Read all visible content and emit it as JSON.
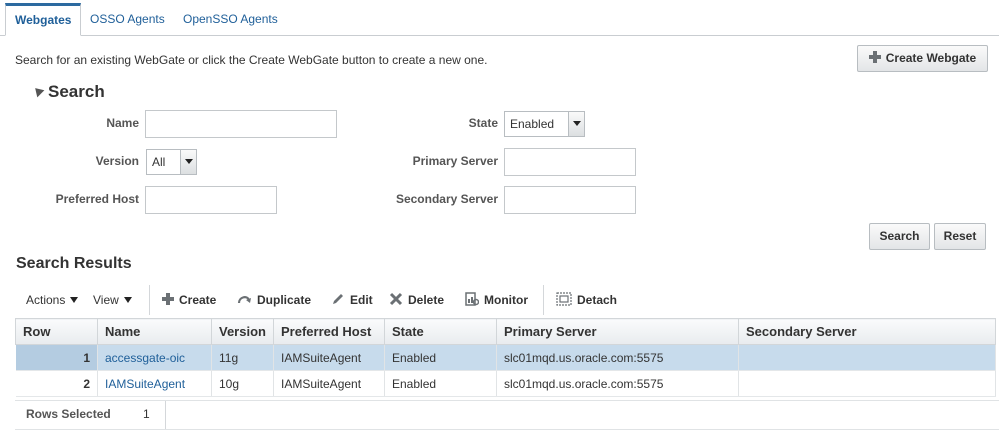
{
  "tabs": [
    {
      "label": "Webgates",
      "active": true
    },
    {
      "label": "OSSO Agents",
      "active": false
    },
    {
      "label": "OpenSSO Agents",
      "active": false
    }
  ],
  "intro_text": "Search for an existing WebGate or click the Create WebGate button to create a new one.",
  "create_button_label": "Create Webgate",
  "search": {
    "title": "Search",
    "fields": {
      "name_label": "Name",
      "state_label": "State",
      "state_value": "Enabled",
      "version_label": "Version",
      "version_value": "All",
      "primary_server_label": "Primary Server",
      "preferred_host_label": "Preferred Host",
      "secondary_server_label": "Secondary Server"
    },
    "search_button": "Search",
    "reset_button": "Reset"
  },
  "results": {
    "title": "Search Results",
    "toolbar": {
      "actions": "Actions",
      "view": "View",
      "create": "Create",
      "duplicate": "Duplicate",
      "edit": "Edit",
      "delete": "Delete",
      "monitor": "Monitor",
      "detach": "Detach"
    },
    "columns": [
      "Row",
      "Name",
      "Version",
      "Preferred Host",
      "State",
      "Primary Server",
      "Secondary Server"
    ],
    "rows": [
      {
        "row": "1",
        "name": "accessgate-oic",
        "version": "11g",
        "preferred_host": "IAMSuiteAgent",
        "state": "Enabled",
        "primary_server": "slc01mqd.us.oracle.com:5575",
        "secondary_server": "",
        "selected": true
      },
      {
        "row": "2",
        "name": "IAMSuiteAgent",
        "version": "10g",
        "preferred_host": "IAMSuiteAgent",
        "state": "Enabled",
        "primary_server": "slc01mqd.us.oracle.com:5575",
        "secondary_server": "",
        "selected": false
      }
    ],
    "rows_selected_label": "Rows Selected",
    "rows_selected_value": "1"
  },
  "colors": {
    "link": "#1f5f99",
    "selected_row": "#c7dbec",
    "tab_accent": "#2c6aa0"
  }
}
